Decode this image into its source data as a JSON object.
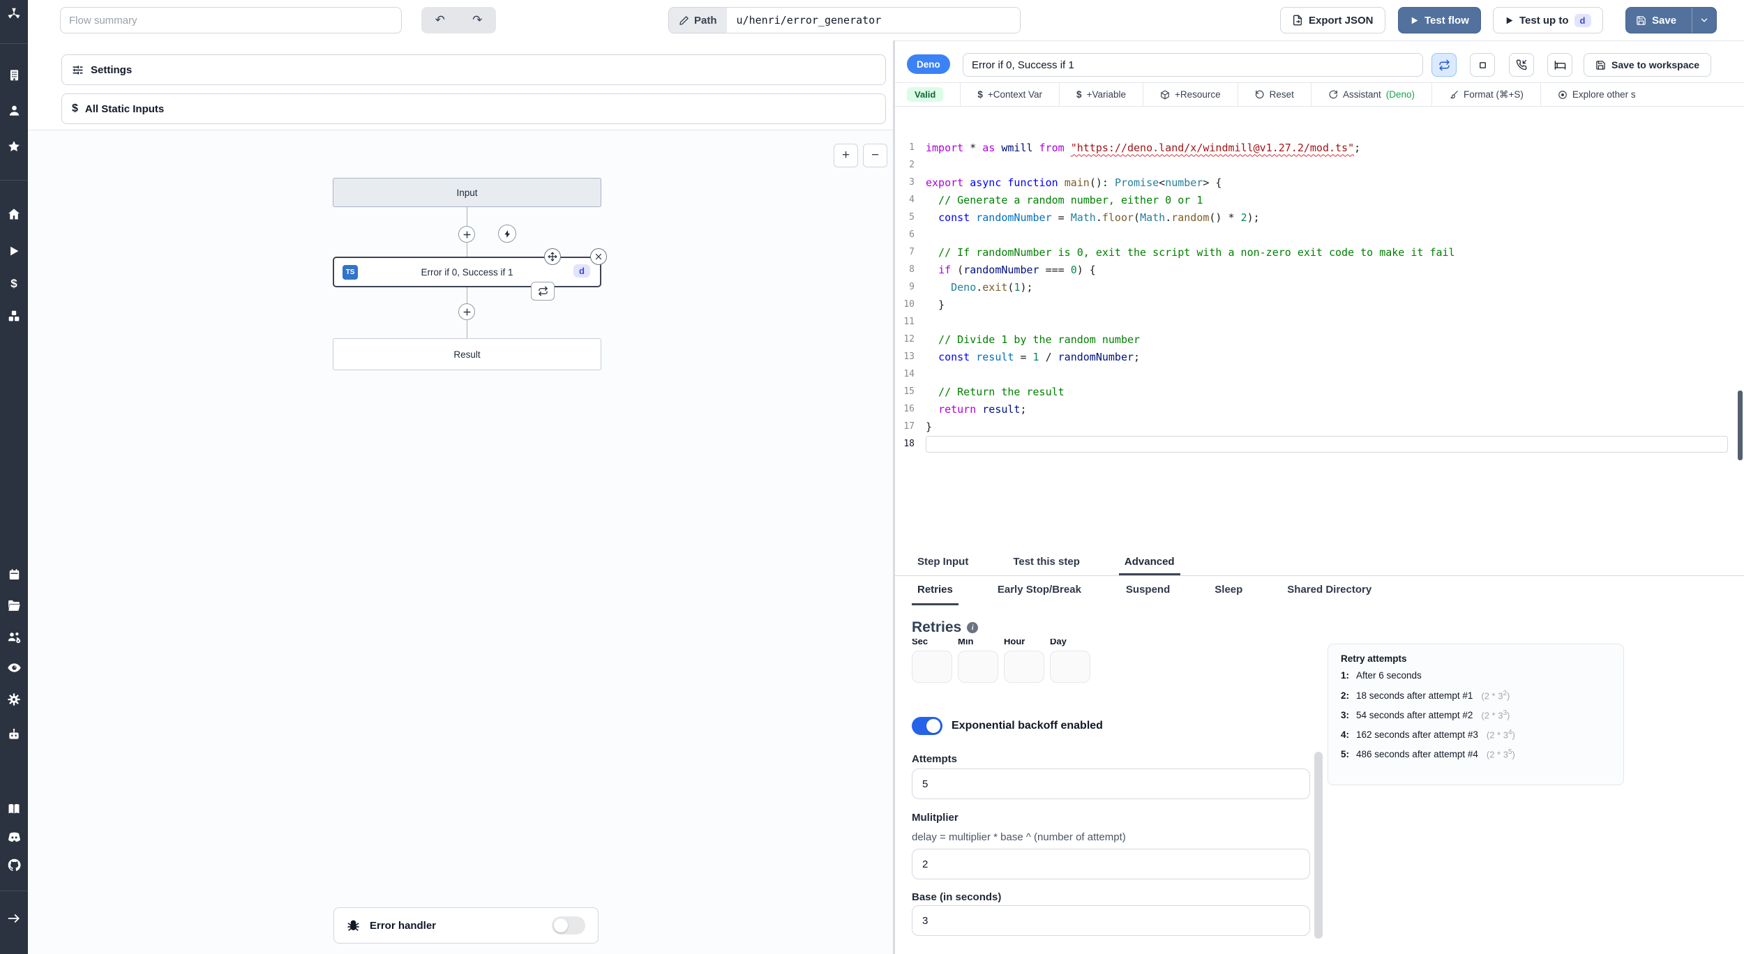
{
  "topbar": {
    "flow_summary_placeholder": "Flow summary",
    "path_label": "Path",
    "path_value": "u/henri/error_generator",
    "export_json_label": "Export JSON",
    "test_flow_label": "Test flow",
    "test_up_to_label": "Test up to",
    "test_up_to_badge": "d",
    "save_label": "Save"
  },
  "sidebar_icons": [
    "windmill-logo",
    "building",
    "user",
    "star",
    "home",
    "play",
    "dollar",
    "cubes",
    "calendar",
    "folder",
    "users-settings",
    "eye",
    "gear",
    "robot",
    "book",
    "discord",
    "github",
    "expand-arrow"
  ],
  "left_panel": {
    "settings_label": "Settings",
    "all_static_inputs_label": "All Static Inputs",
    "zoom_in_label": "+",
    "zoom_out_label": "−",
    "flow": {
      "input_node_label": "Input",
      "step_node": {
        "lang_badge": "TS",
        "label": "Error if 0, Success if 1",
        "id_badge": "d"
      },
      "result_node_label": "Result"
    },
    "error_handler_label": "Error handler",
    "error_handler_enabled": false
  },
  "editor": {
    "lang_badge": "Deno",
    "title_value": "Error if 0, Success if 1",
    "save_to_workspace_label": "Save to workspace",
    "toolbar": {
      "valid_label": "Valid",
      "context_var_label": "+Context Var",
      "variable_label": "+Variable",
      "resource_label": "+Resource",
      "reset_label": "Reset",
      "assistant_label": "Assistant",
      "assistant_lang": "(Deno)",
      "format_label": "Format (⌘+S)",
      "explore_label": "Explore other s"
    },
    "code_lines": [
      {
        "n": 1,
        "tokens": [
          [
            "kw",
            "import"
          ],
          [
            "pln",
            " * "
          ],
          [
            "kw",
            "as"
          ],
          [
            "pln",
            " "
          ],
          [
            "var",
            "wmill"
          ],
          [
            "pln",
            " "
          ],
          [
            "kw",
            "from"
          ],
          [
            "pln",
            " "
          ],
          [
            "strerr",
            "\"https://deno.land/x/windmill@v1.27.2/mod.ts\""
          ],
          [
            "pln",
            ";"
          ]
        ]
      },
      {
        "n": 2,
        "tokens": []
      },
      {
        "n": 3,
        "tokens": [
          [
            "kw",
            "export"
          ],
          [
            "pln",
            " "
          ],
          [
            "kw2",
            "async"
          ],
          [
            "pln",
            " "
          ],
          [
            "kw2",
            "function"
          ],
          [
            "pln",
            " "
          ],
          [
            "fn",
            "main"
          ],
          [
            "pln",
            "(): "
          ],
          [
            "type",
            "Promise"
          ],
          [
            "pln",
            "<"
          ],
          [
            "type",
            "number"
          ],
          [
            "pln",
            "> {"
          ]
        ]
      },
      {
        "n": 4,
        "tokens": [
          [
            "com",
            "  // Generate a random number, either 0 or 1"
          ]
        ]
      },
      {
        "n": 5,
        "tokens": [
          [
            "pln",
            "  "
          ],
          [
            "kw2",
            "const"
          ],
          [
            "pln",
            " "
          ],
          [
            "const",
            "randomNumber"
          ],
          [
            "pln",
            " = "
          ],
          [
            "type",
            "Math"
          ],
          [
            "pln",
            "."
          ],
          [
            "fn",
            "floor"
          ],
          [
            "pln",
            "("
          ],
          [
            "type",
            "Math"
          ],
          [
            "pln",
            "."
          ],
          [
            "fn",
            "random"
          ],
          [
            "pln",
            "() * "
          ],
          [
            "num",
            "2"
          ],
          [
            "pln",
            ");"
          ]
        ]
      },
      {
        "n": 6,
        "tokens": []
      },
      {
        "n": 7,
        "tokens": [
          [
            "com",
            "  // If randomNumber is 0, exit the script with a non-zero exit code to make it fail"
          ]
        ]
      },
      {
        "n": 8,
        "tokens": [
          [
            "pln",
            "  "
          ],
          [
            "kw",
            "if"
          ],
          [
            "pln",
            " ("
          ],
          [
            "var",
            "randomNumber"
          ],
          [
            "pln",
            " === "
          ],
          [
            "num",
            "0"
          ],
          [
            "pln",
            ") {"
          ]
        ]
      },
      {
        "n": 9,
        "tokens": [
          [
            "pln",
            "    "
          ],
          [
            "type",
            "Deno"
          ],
          [
            "pln",
            "."
          ],
          [
            "fn",
            "exit"
          ],
          [
            "pln",
            "("
          ],
          [
            "num",
            "1"
          ],
          [
            "pln",
            ");"
          ]
        ]
      },
      {
        "n": 10,
        "tokens": [
          [
            "pln",
            "  }"
          ]
        ]
      },
      {
        "n": 11,
        "tokens": []
      },
      {
        "n": 12,
        "tokens": [
          [
            "com",
            "  // Divide 1 by the random number"
          ]
        ]
      },
      {
        "n": 13,
        "tokens": [
          [
            "pln",
            "  "
          ],
          [
            "kw2",
            "const"
          ],
          [
            "pln",
            " "
          ],
          [
            "const",
            "result"
          ],
          [
            "pln",
            " = "
          ],
          [
            "num",
            "1"
          ],
          [
            "pln",
            " / "
          ],
          [
            "var",
            "randomNumber"
          ],
          [
            "pln",
            ";"
          ]
        ]
      },
      {
        "n": 14,
        "tokens": []
      },
      {
        "n": 15,
        "tokens": [
          [
            "com",
            "  // Return the result"
          ]
        ]
      },
      {
        "n": 16,
        "tokens": [
          [
            "pln",
            "  "
          ],
          [
            "kw",
            "return"
          ],
          [
            "pln",
            " "
          ],
          [
            "var",
            "result"
          ],
          [
            "pln",
            ";"
          ]
        ]
      },
      {
        "n": 17,
        "tokens": [
          [
            "pln",
            "}"
          ]
        ]
      },
      {
        "n": 18,
        "tokens": [],
        "active": true
      }
    ]
  },
  "panel": {
    "tabs": [
      {
        "label": "Step Input",
        "active": false
      },
      {
        "label": "Test this step",
        "active": false
      },
      {
        "label": "Advanced",
        "active": true
      }
    ],
    "advanced_tabs": [
      {
        "label": "Retries",
        "active": true
      },
      {
        "label": "Early Stop/Break",
        "active": false
      },
      {
        "label": "Suspend",
        "active": false
      },
      {
        "label": "Sleep",
        "active": false
      },
      {
        "label": "Shared Directory",
        "active": false
      }
    ],
    "retries": {
      "heading": "Retries",
      "time_fields": [
        "Sec",
        "Min",
        "Hour",
        "Day"
      ],
      "backoff_toggle_label": "Exponential backoff enabled",
      "backoff_enabled": true,
      "attempts_label": "Attempts",
      "attempts_value": "5",
      "multiplier_label": "Mulitplier",
      "multiplier_help": "delay = multiplier * base ^ (number of attempt)",
      "multiplier_value": "2",
      "base_label": "Base (in seconds)",
      "base_value": "3",
      "retry_attempts": {
        "title": "Retry attempts",
        "items": [
          {
            "n": "1:",
            "text": "After 6 seconds",
            "formula_base": "",
            "formula_sup": "",
            "formula_close": ""
          },
          {
            "n": "2:",
            "text": "18 seconds after attempt #1",
            "formula_base": "(2 * 3",
            "formula_sup": "2",
            "formula_close": ")"
          },
          {
            "n": "3:",
            "text": "54 seconds after attempt #2",
            "formula_base": "(2 * 3",
            "formula_sup": "3",
            "formula_close": ")"
          },
          {
            "n": "4:",
            "text": "162 seconds after attempt #3",
            "formula_base": "(2 * 3",
            "formula_sup": "4",
            "formula_close": ")"
          },
          {
            "n": "5:",
            "text": "486 seconds after attempt #4",
            "formula_base": "(2 * 3",
            "formula_sup": "5",
            "formula_close": ")"
          }
        ]
      }
    }
  },
  "colors": {
    "sidebar_bg": "#2b3240",
    "accent_button_blue": "#52719d",
    "deno_badge_blue": "#3b82f6",
    "valid_bg": "#dcfce7",
    "valid_text": "#166534",
    "toggle_on_blue": "#2563eb",
    "d_badge_bg": "#e0e4fd",
    "d_badge_text": "#4444d8",
    "ts_badge_blue": "#3075c9"
  }
}
